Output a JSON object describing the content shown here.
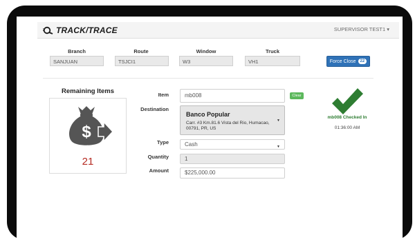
{
  "header": {
    "logo_text": "TRACK/TRACE",
    "user_menu": "SUPERVISOR TEST1 ▾"
  },
  "route_info": {
    "branch": {
      "label": "Branch",
      "value": "SANJUAN"
    },
    "route": {
      "label": "Route",
      "value": "TSJCI1"
    },
    "window": {
      "label": "Window",
      "value": "W3"
    },
    "truck": {
      "label": "Truck",
      "value": "VH1"
    },
    "force_close_label": "Force Close",
    "force_close_count": "22"
  },
  "remaining": {
    "title": "Remaining Items",
    "count": "21",
    "icon": "money-bag-arrow-icon"
  },
  "form": {
    "item_label": "Item",
    "item_value": "mb008",
    "clear_label": "Clear",
    "destination_label": "Destination",
    "destination_name": "Banco Popular",
    "destination_address": "Carr. #3 Km.81.6 Vista del Rio, Humacao, 00791, PR, US",
    "type_label": "Type",
    "type_value": "Cash",
    "quantity_label": "Quantity",
    "quantity_value": "1",
    "amount_label": "Amount",
    "amount_value": "$225,000.00"
  },
  "status": {
    "message": "mb008 Checked In",
    "time": "01:36:00 AM",
    "icon": "checkmark-icon"
  },
  "colors": {
    "accent_blue": "#2f72b7",
    "success_green": "#2e7d32",
    "count_red": "#b52a21",
    "clear_green": "#5cb85c"
  }
}
